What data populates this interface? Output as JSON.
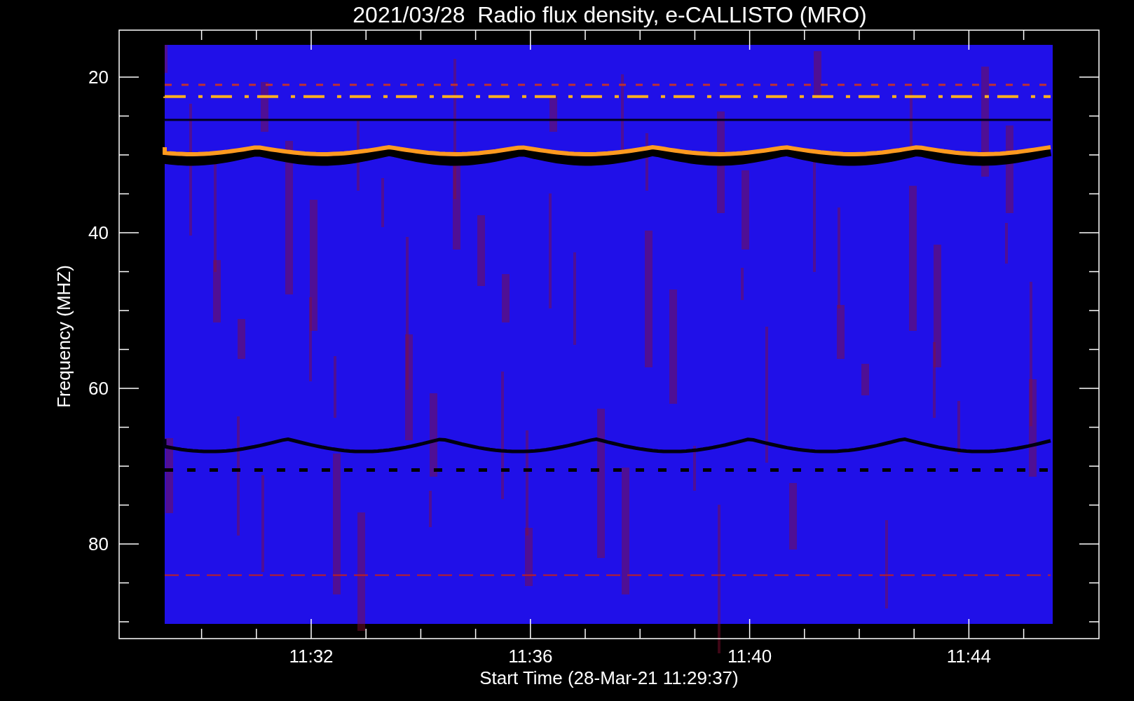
{
  "title": "2021/03/28  Radio flux density, e-CALLISTO (MRO)",
  "y_axis": {
    "label": "Frequency (MHZ)",
    "ticks": [
      "20",
      "40",
      "60",
      "80"
    ]
  },
  "x_axis": {
    "label": "Start Time (28-Mar-21 11:29:37)",
    "ticks": [
      "11:32",
      "11:36",
      "11:40",
      "11:44"
    ]
  }
}
